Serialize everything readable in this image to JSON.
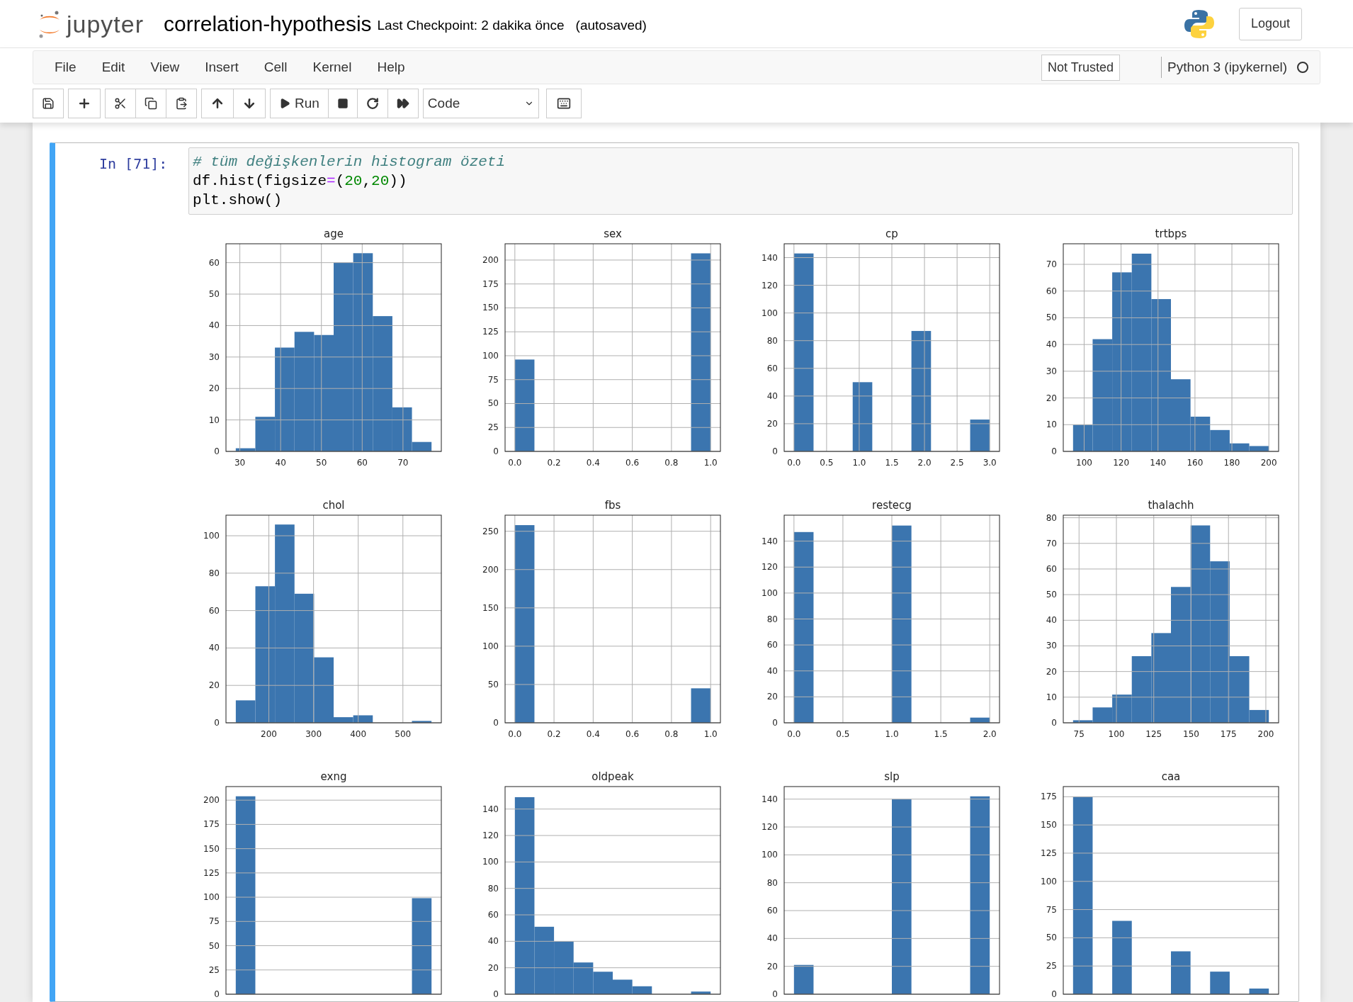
{
  "header": {
    "logo_text": "jupyter",
    "notebook_name": "correlation-hypothesis",
    "checkpoint": "Last Checkpoint: 2 dakika önce",
    "autosave_status": "(autosaved)",
    "logout": "Logout"
  },
  "menu": [
    "File",
    "Edit",
    "View",
    "Insert",
    "Cell",
    "Kernel",
    "Help"
  ],
  "trust": "Not Trusted",
  "kernel": {
    "name": "Python 3 (ipykernel)",
    "busy": false
  },
  "toolbar": {
    "run_label": "Run",
    "cell_type": "Code"
  },
  "cell": {
    "prompt": "In [71]:",
    "selected": true,
    "lines": [
      [
        {
          "t": "# tüm değişkenlerin histogram özeti",
          "kind": "comment"
        }
      ],
      [
        {
          "t": "df.hist(figsize",
          "kind": "plain"
        },
        {
          "t": "=",
          "kind": "operator"
        },
        {
          "t": "(",
          "kind": "plain"
        },
        {
          "t": "20",
          "kind": "number"
        },
        {
          "t": ",",
          "kind": "plain"
        },
        {
          "t": "20",
          "kind": "number"
        },
        {
          "t": "))",
          "kind": "plain"
        }
      ],
      [
        {
          "t": "plt.show()",
          "kind": "plain"
        }
      ]
    ]
  },
  "histograms": [
    {
      "chart_data": {
        "type": "bar",
        "title": "age",
        "grid": true,
        "x": [
          31.4,
          36.2,
          41,
          45.8,
          50.6,
          55.4,
          60.2,
          65,
          69.8,
          74.6
        ],
        "series": [
          {
            "color": "#3b75af",
            "values": [
              1,
              11,
              33,
              38,
              37,
              60,
              63,
              43,
              14,
              3
            ]
          }
        ],
        "xlim": [
          26.6,
          79.4
        ],
        "ylim": [
          0,
          66
        ],
        "xticks": [
          30,
          40,
          50,
          60,
          70
        ],
        "yticks": [
          0,
          10,
          20,
          30,
          40,
          50,
          60
        ]
      }
    },
    {
      "chart_data": {
        "type": "bar",
        "title": "sex",
        "grid": true,
        "x": [
          0.05,
          0.15,
          0.25,
          0.35,
          0.45,
          0.55,
          0.65,
          0.75,
          0.85,
          0.95
        ],
        "series": [
          {
            "color": "#3b75af",
            "values": [
              96,
              0,
              0,
              0,
              0,
              0,
              0,
              0,
              0,
              207
            ]
          }
        ],
        "xlim": [
          -0.05,
          1.05
        ],
        "ylim": [
          0,
          217
        ],
        "xticks": [
          {
            "value": 0,
            "label": "0.0"
          },
          {
            "value": 0.2,
            "label": "0.2"
          },
          {
            "value": 0.4,
            "label": "0.4"
          },
          {
            "value": 0.6,
            "label": "0.6"
          },
          {
            "value": 0.8,
            "label": "0.8"
          },
          {
            "value": 1,
            "label": "1.0"
          }
        ],
        "yticks": [
          0,
          25,
          50,
          75,
          100,
          125,
          150,
          175,
          200
        ]
      }
    },
    {
      "chart_data": {
        "type": "bar",
        "title": "cp",
        "grid": true,
        "x": [
          0.15,
          0.45,
          0.75,
          1.05,
          1.35,
          1.65,
          1.95,
          2.25,
          2.55,
          2.85
        ],
        "series": [
          {
            "color": "#3b75af",
            "values": [
              143,
              0,
              0,
              50,
              0,
              0,
              87,
              0,
              0,
              23
            ]
          }
        ],
        "xlim": [
          -0.15,
          3.15
        ],
        "ylim": [
          0,
          150
        ],
        "xticks": [
          {
            "value": 0,
            "label": "0.0"
          },
          {
            "value": 0.5,
            "label": "0.5"
          },
          {
            "value": 1,
            "label": "1.0"
          },
          {
            "value": 1.5,
            "label": "1.5"
          },
          {
            "value": 2,
            "label": "2.0"
          },
          {
            "value": 2.5,
            "label": "2.5"
          },
          {
            "value": 3,
            "label": "3.0"
          }
        ],
        "yticks": [
          0,
          20,
          40,
          60,
          80,
          100,
          120,
          140
        ]
      }
    },
    {
      "chart_data": {
        "type": "bar",
        "title": "trtbps",
        "grid": true,
        "x": [
          99.3,
          109.9,
          120.5,
          131.1,
          141.7,
          152.3,
          162.9,
          173.5,
          184.1,
          194.7
        ],
        "series": [
          {
            "color": "#3b75af",
            "values": [
              10,
              42,
              67,
              74,
              57,
              27,
              13,
              8,
              3,
              2
            ]
          }
        ],
        "xlim": [
          88.7,
          205.3
        ],
        "ylim": [
          0,
          77.7
        ],
        "xticks": [
          100,
          120,
          140,
          160,
          180,
          200
        ],
        "yticks": [
          0,
          10,
          20,
          30,
          40,
          50,
          60,
          70
        ]
      }
    },
    {
      "chart_data": {
        "type": "bar",
        "title": "chol",
        "grid": true,
        "x": [
          147.9,
          191.7,
          235.5,
          279.3,
          323.1,
          366.9,
          410.7,
          454.5,
          498.3,
          542.1
        ],
        "series": [
          {
            "color": "#3b75af",
            "values": [
              12,
              73,
              106,
              69,
              35,
              3,
              4,
              0,
              0,
              1
            ]
          }
        ],
        "xlim": [
          104,
          586
        ],
        "ylim": [
          0,
          111
        ],
        "xticks": [
          200,
          300,
          400,
          500
        ],
        "yticks": [
          0,
          20,
          40,
          60,
          80,
          100
        ]
      }
    },
    {
      "chart_data": {
        "type": "bar",
        "title": "fbs",
        "grid": true,
        "x": [
          0.05,
          0.15,
          0.25,
          0.35,
          0.45,
          0.55,
          0.65,
          0.75,
          0.85,
          0.95
        ],
        "series": [
          {
            "color": "#3b75af",
            "values": [
              258,
              0,
              0,
              0,
              0,
              0,
              0,
              0,
              0,
              45
            ]
          }
        ],
        "xlim": [
          -0.05,
          1.05
        ],
        "ylim": [
          0,
          271
        ],
        "xticks": [
          {
            "value": 0,
            "label": "0.0"
          },
          {
            "value": 0.2,
            "label": "0.2"
          },
          {
            "value": 0.4,
            "label": "0.4"
          },
          {
            "value": 0.6,
            "label": "0.6"
          },
          {
            "value": 0.8,
            "label": "0.8"
          },
          {
            "value": 1,
            "label": "1.0"
          }
        ],
        "yticks": [
          0,
          50,
          100,
          150,
          200,
          250
        ]
      }
    },
    {
      "chart_data": {
        "type": "bar",
        "title": "restecg",
        "grid": true,
        "x": [
          0.1,
          0.3,
          0.5,
          0.7,
          0.9,
          1.1,
          1.3,
          1.5,
          1.7,
          1.9
        ],
        "series": [
          {
            "color": "#3b75af",
            "values": [
              147,
              0,
              0,
              0,
              0,
              152,
              0,
              0,
              0,
              4
            ]
          }
        ],
        "xlim": [
          -0.1,
          2.1
        ],
        "ylim": [
          0,
          160
        ],
        "xticks": [
          {
            "value": 0,
            "label": "0.0"
          },
          {
            "value": 0.5,
            "label": "0.5"
          },
          {
            "value": 1,
            "label": "1.0"
          },
          {
            "value": 1.5,
            "label": "1.5"
          },
          {
            "value": 2,
            "label": "2.0"
          }
        ],
        "yticks": [
          0,
          20,
          40,
          60,
          80,
          100,
          120,
          140
        ]
      }
    },
    {
      "chart_data": {
        "type": "bar",
        "title": "thalachh",
        "grid": true,
        "x": [
          77.55,
          90.65,
          103.75,
          116.85,
          129.95,
          143.05,
          156.15,
          169.25,
          182.35,
          195.45
        ],
        "series": [
          {
            "color": "#3b75af",
            "values": [
              1,
              6,
              11,
              26,
              35,
              53,
              77,
              63,
              26,
              5
            ]
          }
        ],
        "xlim": [
          64.45,
          208.55
        ],
        "ylim": [
          0,
          81
        ],
        "xticks": [
          75,
          100,
          125,
          150,
          175,
          200
        ],
        "yticks": [
          0,
          10,
          20,
          30,
          40,
          50,
          60,
          70,
          80
        ]
      }
    },
    {
      "chart_data": {
        "type": "bar",
        "title": "exng",
        "grid": true,
        "categories": [
          null,
          null,
          null,
          null,
          null,
          null,
          null,
          null,
          null,
          null
        ],
        "series": [
          {
            "color": "#3b75af",
            "values": [
              204,
              0,
              0,
              0,
              0,
              0,
              0,
              0,
              0,
              99
            ]
          }
        ],
        "ylim": [
          0,
          214
        ],
        "yticks": [
          0,
          25,
          50,
          75,
          100,
          125,
          150,
          175,
          200
        ]
      }
    },
    {
      "chart_data": {
        "type": "bar",
        "title": "oldpeak",
        "grid": true,
        "categories": [
          null,
          null,
          null,
          null,
          null,
          null,
          null,
          null,
          null,
          null
        ],
        "series": [
          {
            "color": "#3b75af",
            "values": [
              149,
              51,
              40,
              24,
              17,
              11,
              6,
              0,
              0,
              2
            ]
          }
        ],
        "ylim": [
          0,
          157
        ],
        "yticks": [
          0,
          20,
          40,
          60,
          80,
          100,
          120,
          140
        ]
      }
    },
    {
      "chart_data": {
        "type": "bar",
        "title": "slp",
        "grid": true,
        "categories": [
          null,
          null,
          null,
          null,
          null,
          null,
          null,
          null,
          null,
          null
        ],
        "series": [
          {
            "color": "#3b75af",
            "values": [
              21,
              0,
              0,
              0,
              0,
              140,
              0,
              0,
              0,
              142
            ]
          }
        ],
        "ylim": [
          0,
          149
        ],
        "yticks": [
          0,
          20,
          40,
          60,
          80,
          100,
          120,
          140
        ]
      }
    },
    {
      "chart_data": {
        "type": "bar",
        "title": "caa",
        "grid": true,
        "categories": [
          null,
          null,
          null,
          null,
          null,
          null,
          null,
          null,
          null,
          null
        ],
        "series": [
          {
            "color": "#3b75af",
            "values": [
              175,
              0,
              65,
              0,
              0,
              38,
              0,
              20,
              0,
              5
            ]
          }
        ],
        "ylim": [
          0,
          184
        ],
        "yticks": [
          0,
          25,
          50,
          75,
          100,
          125,
          150,
          175
        ]
      }
    }
  ]
}
